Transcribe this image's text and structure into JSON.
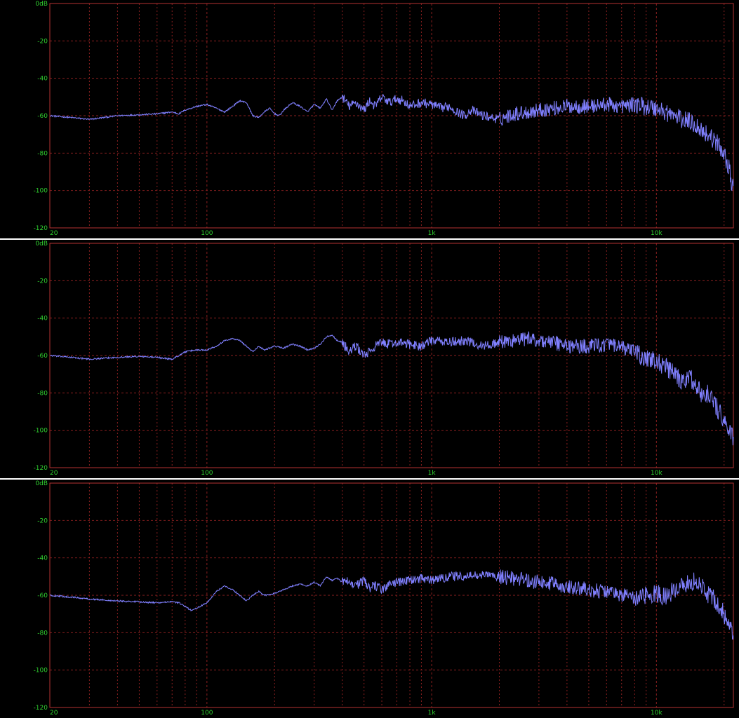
{
  "colors": {
    "background": "#000000",
    "grid": "#8a1f1f",
    "frame": "#b53232",
    "trace": "#8080ff",
    "tick_text": "#2fd12f"
  },
  "chart_data": [
    {
      "type": "line",
      "title": "",
      "xscale": "log",
      "xlim": [
        20,
        22000
      ],
      "ylim": [
        -120,
        0
      ],
      "x_tick_labels": [
        "20",
        "100",
        "1k",
        "10k"
      ],
      "y_tick_labels": [
        "0dB",
        "-20",
        "-40",
        "-60",
        "-80",
        "-100",
        "-120"
      ],
      "grid": true,
      "series": [
        {
          "x": [
            20,
            25,
            30,
            40,
            50,
            60,
            70,
            75,
            80,
            90,
            100,
            110,
            120,
            130,
            140,
            150,
            160,
            170,
            180,
            190,
            200,
            210,
            220,
            240,
            260,
            280,
            300,
            320,
            340,
            360,
            380,
            400,
            430,
            460,
            500,
            530,
            560,
            600,
            650,
            700,
            750,
            800,
            900,
            1000,
            1100,
            1200,
            1300,
            1400,
            1500,
            1700,
            2000,
            2300,
            2700,
            3000,
            3500,
            4000,
            5000,
            6000,
            7000,
            8000,
            9000,
            10000,
            11000,
            12000,
            13000,
            14000,
            15000,
            16000,
            17000,
            18000,
            19000,
            20000,
            21000,
            22000
          ],
          "y": [
            -60,
            -61,
            -62,
            -60,
            -59.5,
            -59,
            -58,
            -59,
            -57,
            -55,
            -54,
            -56,
            -58,
            -55,
            -52,
            -53,
            -60,
            -61,
            -58,
            -56,
            -59,
            -60,
            -57,
            -53,
            -55,
            -58,
            -54,
            -56,
            -51,
            -57,
            -52,
            -50,
            -55,
            -53,
            -57,
            -52,
            -55,
            -50,
            -53,
            -51,
            -52,
            -55,
            -53,
            -54,
            -56,
            -55,
            -58,
            -60,
            -57,
            -60,
            -62,
            -59,
            -58,
            -57,
            -56,
            -55,
            -55,
            -54,
            -55,
            -54,
            -55,
            -56,
            -58,
            -60,
            -62,
            -63,
            -65,
            -68,
            -70,
            -73,
            -76,
            -80,
            -88,
            -100
          ]
        }
      ]
    },
    {
      "type": "line",
      "title": "",
      "xscale": "log",
      "xlim": [
        20,
        22000
      ],
      "ylim": [
        -120,
        0
      ],
      "x_tick_labels": [
        "20",
        "100",
        "1k",
        "10k"
      ],
      "y_tick_labels": [
        "0dB",
        "-20",
        "-40",
        "-60",
        "-80",
        "-100",
        "-120"
      ],
      "grid": true,
      "series": [
        {
          "x": [
            20,
            25,
            30,
            40,
            50,
            60,
            70,
            75,
            80,
            90,
            100,
            110,
            120,
            130,
            140,
            150,
            160,
            170,
            180,
            200,
            220,
            240,
            260,
            280,
            300,
            320,
            340,
            360,
            380,
            400,
            430,
            460,
            500,
            530,
            560,
            600,
            650,
            700,
            800,
            900,
            1000,
            1200,
            1400,
            1700,
            2000,
            2300,
            2700,
            3000,
            3500,
            4000,
            5000,
            6000,
            7000,
            8000,
            9000,
            10000,
            11000,
            12000,
            13000,
            14000,
            15000,
            16000,
            17000,
            18000,
            19000,
            20000,
            21000,
            22000
          ],
          "y": [
            -60,
            -61,
            -62,
            -61,
            -60.5,
            -61,
            -62,
            -60,
            -58,
            -57,
            -57,
            -55,
            -52,
            -51,
            -52,
            -55,
            -58,
            -55,
            -57,
            -55,
            -56,
            -54,
            -55,
            -57,
            -56,
            -54,
            -50,
            -49,
            -52,
            -53,
            -58,
            -55,
            -60,
            -58,
            -55,
            -53,
            -54,
            -53,
            -54,
            -55,
            -52,
            -53,
            -52,
            -55,
            -53,
            -52,
            -51,
            -52,
            -53,
            -55,
            -55,
            -54,
            -56,
            -58,
            -62,
            -63,
            -66,
            -70,
            -75,
            -71,
            -76,
            -82,
            -80,
            -85,
            -90,
            -95,
            -100,
            -105
          ]
        }
      ]
    },
    {
      "type": "line",
      "title": "",
      "xscale": "log",
      "xlim": [
        20,
        22000
      ],
      "ylim": [
        -120,
        0
      ],
      "x_tick_labels": [
        "20",
        "100",
        "1k",
        "10k"
      ],
      "y_tick_labels": [
        "0dB",
        "-20",
        "-40",
        "-60",
        "-80",
        "-100",
        "-120"
      ],
      "grid": true,
      "series": [
        {
          "x": [
            20,
            25,
            30,
            40,
            50,
            60,
            70,
            75,
            80,
            85,
            90,
            100,
            110,
            120,
            130,
            140,
            150,
            160,
            170,
            180,
            200,
            220,
            240,
            260,
            280,
            300,
            320,
            340,
            360,
            380,
            400,
            430,
            460,
            500,
            530,
            560,
            600,
            650,
            700,
            800,
            900,
            1000,
            1200,
            1400,
            1700,
            2000,
            2300,
            2700,
            3000,
            3500,
            4000,
            5000,
            6000,
            7000,
            8000,
            9000,
            10000,
            11000,
            12000,
            13000,
            14000,
            15000,
            16000,
            17000,
            18000,
            19000,
            20000,
            21000,
            22000
          ],
          "y": [
            -60,
            -61,
            -62,
            -63,
            -63.5,
            -64,
            -63.5,
            -64,
            -66,
            -68,
            -67,
            -64,
            -58,
            -55,
            -57,
            -60,
            -63,
            -60,
            -58,
            -60,
            -59,
            -57,
            -55,
            -54,
            -55,
            -53,
            -55,
            -50,
            -52,
            -51,
            -53,
            -52,
            -55,
            -52,
            -56,
            -55,
            -57,
            -54,
            -53,
            -52,
            -51,
            -52,
            -50,
            -50,
            -49,
            -50,
            -51,
            -52,
            -53,
            -54,
            -55,
            -57,
            -58,
            -60,
            -61,
            -60,
            -59,
            -61,
            -57,
            -55,
            -53,
            -52,
            -56,
            -60,
            -62,
            -66,
            -70,
            -76,
            -82
          ]
        }
      ]
    }
  ]
}
